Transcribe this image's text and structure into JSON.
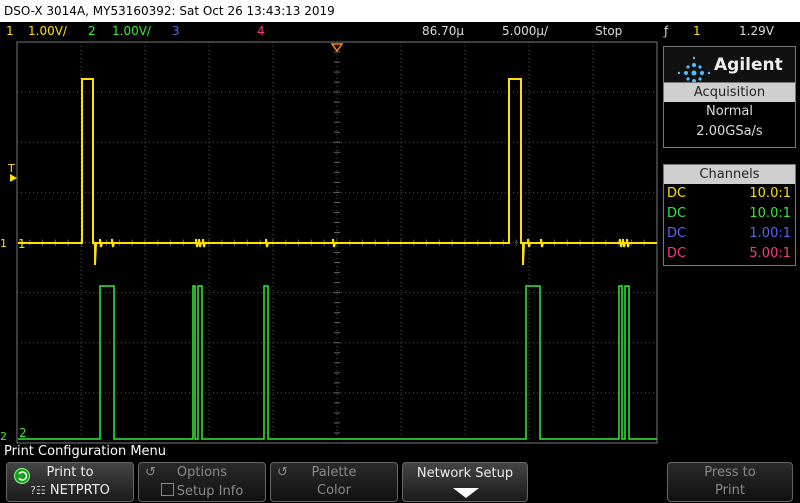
{
  "title_bar": {
    "text": "DSO-X 3014A, MY53160392: Sat Oct 26 13:43:13 2019"
  },
  "status": {
    "ch1_label": "1",
    "ch1_scale": "1.00V/",
    "ch2_label": "2",
    "ch2_scale": "1.00V/",
    "ch3_label": "3",
    "ch4_label": "4",
    "time_delay": "86.70µ",
    "time_scale": "5.000µ/",
    "run_state": "Stop",
    "trigger_icon": "ƒ",
    "trigger_channel": "1",
    "trigger_level": "1.29V"
  },
  "screen": {
    "ch1_marker": "1",
    "ch2_marker": "2",
    "trigger_marker": "T",
    "trigger_position_icon": "triangle-down-icon"
  },
  "side": {
    "brand": "Agilent",
    "acquisition": {
      "header": "Acquisition",
      "mode": "Normal",
      "rate": "2.00GSa/s"
    },
    "channels": {
      "header": "Channels",
      "rows": [
        {
          "coupling": "DC",
          "probe": "10.0:1"
        },
        {
          "coupling": "DC",
          "probe": "10.0:1"
        },
        {
          "coupling": "DC",
          "probe": "1.00:1"
        },
        {
          "coupling": "DC",
          "probe": "5.00:1"
        }
      ]
    }
  },
  "menu": {
    "title": "Print Configuration Menu",
    "softkeys": {
      "print_to": {
        "line1": "Print to",
        "line2": "NETPRTO"
      },
      "options": {
        "line1": "Options",
        "line2": "Setup Info"
      },
      "palette": {
        "line1": "Palette",
        "line2": "Color"
      },
      "network_setup": {
        "line1": "Network Setup"
      },
      "press_to_print": {
        "line1": "Press to",
        "line2": "Print"
      }
    }
  },
  "colors": {
    "ch1": "#ffe000",
    "ch2": "#33ee33",
    "ch3": "#5566ff",
    "ch4": "#ff3388",
    "trigger": "#ff8800"
  }
}
